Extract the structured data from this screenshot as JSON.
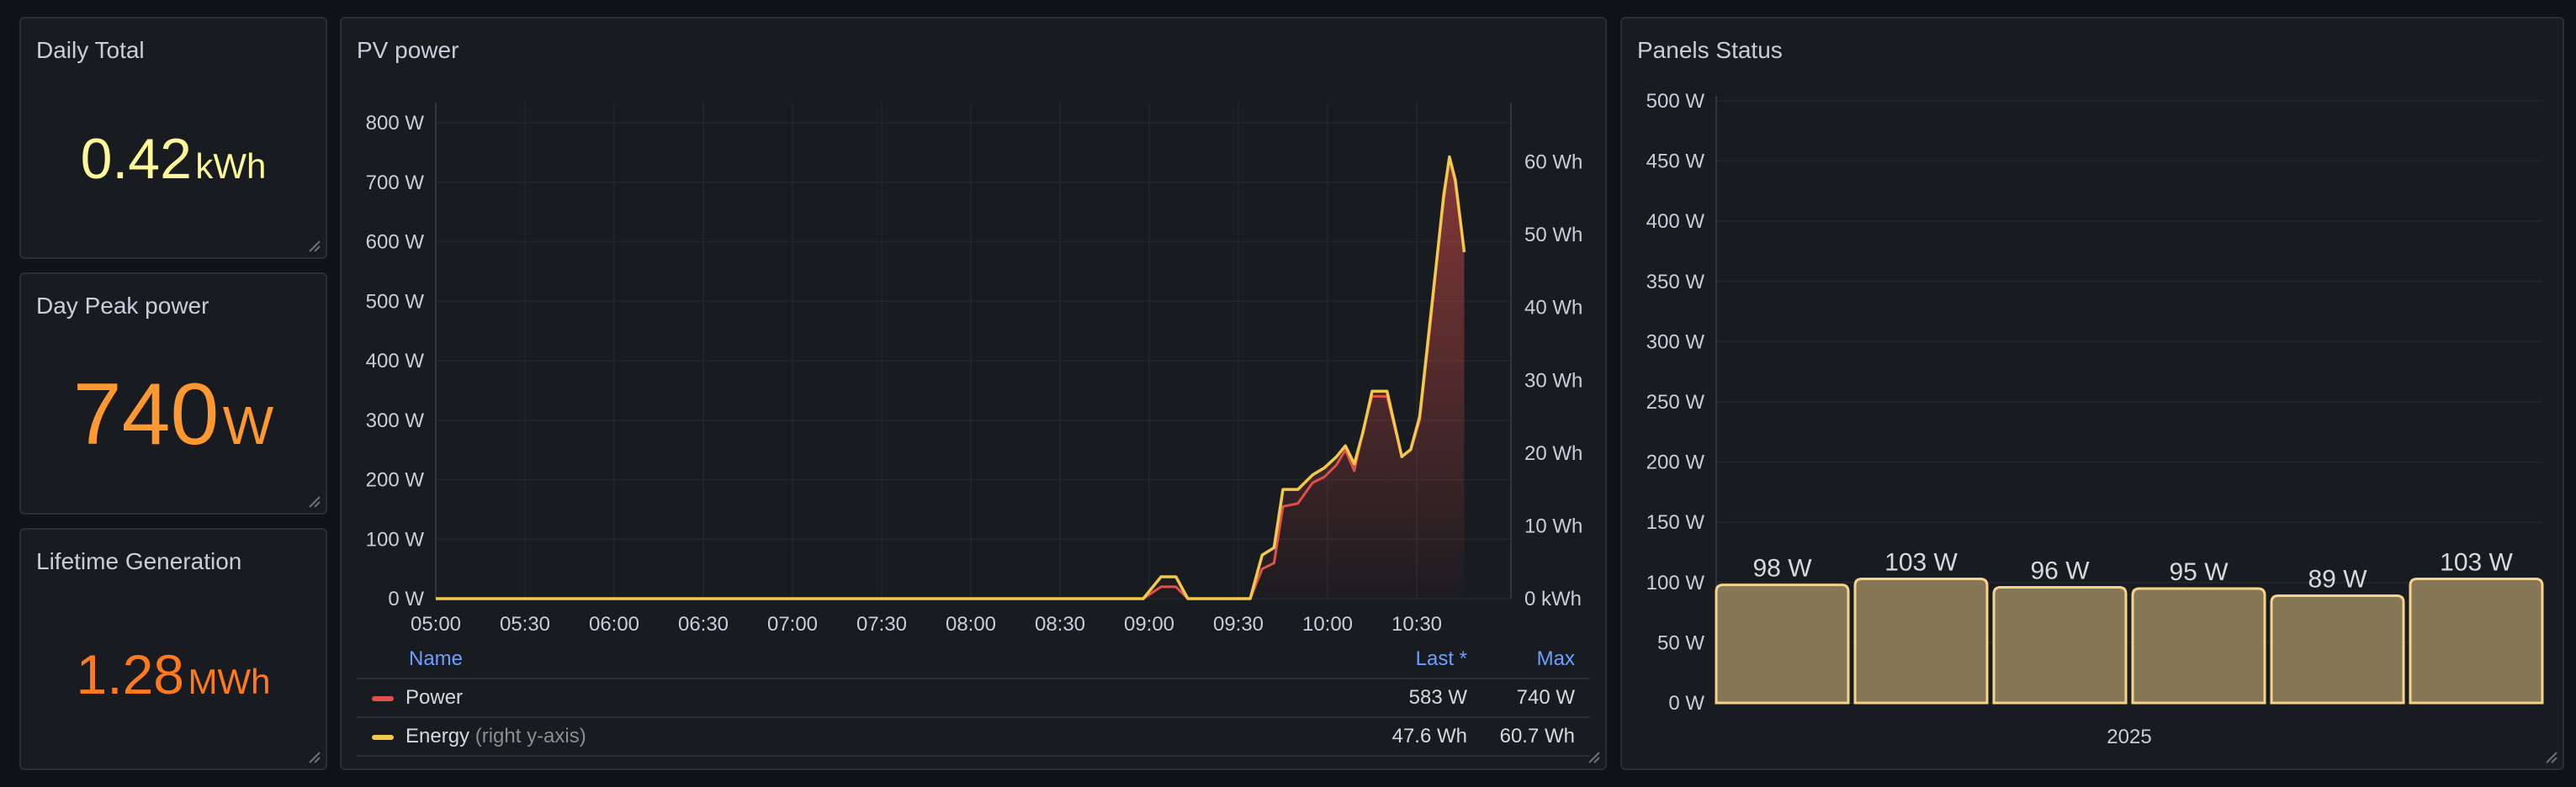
{
  "stats": [
    {
      "title": "Daily Total",
      "value": "0.42",
      "unit": "kWh",
      "color": "#fff899"
    },
    {
      "title": "Day Peak power",
      "value": "740",
      "unit": "W",
      "color": "#ff9830"
    },
    {
      "title": "Lifetime Generation",
      "value": "1.28",
      "unit": "MWh",
      "color": "#ff7a1f"
    }
  ],
  "pv_panel": {
    "title": "PV power",
    "legend": {
      "headers": {
        "name": "Name",
        "last": "Last *",
        "max": "Max"
      },
      "rows": [
        {
          "name": "Power",
          "suffix": "",
          "last": "583 W",
          "max": "740 W",
          "color": "#e0504c"
        },
        {
          "name": "Energy",
          "suffix": "(right y-axis)",
          "last": "47.6 Wh",
          "max": "60.7 Wh",
          "color": "#f2c94c"
        }
      ]
    }
  },
  "panels_status": {
    "title": "Panels Status"
  },
  "chart_data": [
    {
      "type": "line",
      "title": "PV power",
      "x": [
        "05:00",
        "05:30",
        "06:00",
        "06:30",
        "07:00",
        "07:30",
        "08:00",
        "08:30",
        "09:00",
        "09:30",
        "10:00",
        "10:30"
      ],
      "y_left_ticks": [
        "0 W",
        "100 W",
        "200 W",
        "300 W",
        "400 W",
        "500 W",
        "600 W",
        "700 W",
        "800 W"
      ],
      "y_right_ticks": [
        "0 kWh",
        "10 Wh",
        "20 Wh",
        "30 Wh",
        "40 Wh",
        "50 Wh",
        "60 Wh"
      ],
      "ylim_left": [
        0,
        820
      ],
      "ylim_right": [
        0,
        67
      ],
      "grid": true,
      "series": [
        {
          "name": "Power",
          "axis": "left",
          "color": "#e0504c",
          "points": [
            [
              "05:00",
              0
            ],
            [
              "08:58",
              0
            ],
            [
              "09:04",
              20
            ],
            [
              "09:09",
              20
            ],
            [
              "09:13",
              0
            ],
            [
              "09:34",
              0
            ],
            [
              "09:38",
              50
            ],
            [
              "09:42",
              60
            ],
            [
              "09:45",
              155
            ],
            [
              "09:50",
              160
            ],
            [
              "09:55",
              195
            ],
            [
              "09:59",
              205
            ],
            [
              "10:03",
              225
            ],
            [
              "10:06",
              250
            ],
            [
              "10:09",
              215
            ],
            [
              "10:12",
              285
            ],
            [
              "10:15",
              340
            ],
            [
              "10:20",
              340
            ],
            [
              "10:25",
              240
            ],
            [
              "10:28",
              250
            ],
            [
              "10:31",
              300
            ],
            [
              "10:35",
              480
            ],
            [
              "10:39",
              680
            ],
            [
              "10:41",
              740
            ],
            [
              "10:43",
              700
            ],
            [
              "10:46",
              583
            ]
          ]
        },
        {
          "name": "Energy",
          "axis": "right",
          "color": "#f2c94c",
          "points": [
            [
              "05:00",
              0
            ],
            [
              "08:58",
              0
            ],
            [
              "09:04",
              3
            ],
            [
              "09:09",
              3
            ],
            [
              "09:13",
              0
            ],
            [
              "09:34",
              0
            ],
            [
              "09:38",
              6
            ],
            [
              "09:42",
              7
            ],
            [
              "09:45",
              15
            ],
            [
              "09:50",
              15
            ],
            [
              "09:55",
              17
            ],
            [
              "09:59",
              18
            ],
            [
              "10:03",
              19.5
            ],
            [
              "10:06",
              21
            ],
            [
              "10:09",
              18.5
            ],
            [
              "10:12",
              23
            ],
            [
              "10:15",
              28.5
            ],
            [
              "10:20",
              28.5
            ],
            [
              "10:25",
              19.5
            ],
            [
              "10:28",
              20.5
            ],
            [
              "10:31",
              25
            ],
            [
              "10:35",
              40
            ],
            [
              "10:39",
              55
            ],
            [
              "10:41",
              60.7
            ],
            [
              "10:43",
              57.5
            ],
            [
              "10:46",
              47.6
            ]
          ]
        }
      ]
    },
    {
      "type": "bar",
      "title": "Panels Status",
      "categories": [
        "2025"
      ],
      "values": [
        98,
        103,
        96,
        95,
        89,
        103
      ],
      "labels": [
        "98 W",
        "103 W",
        "96 W",
        "95 W",
        "89 W",
        "103 W"
      ],
      "y_ticks": [
        "0 W",
        "50 W",
        "100 W",
        "150 W",
        "200 W",
        "250 W",
        "300 W",
        "350 W",
        "400 W",
        "450 W",
        "500 W"
      ],
      "ylim": [
        0,
        500
      ],
      "grid": true,
      "color": "#857656"
    }
  ]
}
